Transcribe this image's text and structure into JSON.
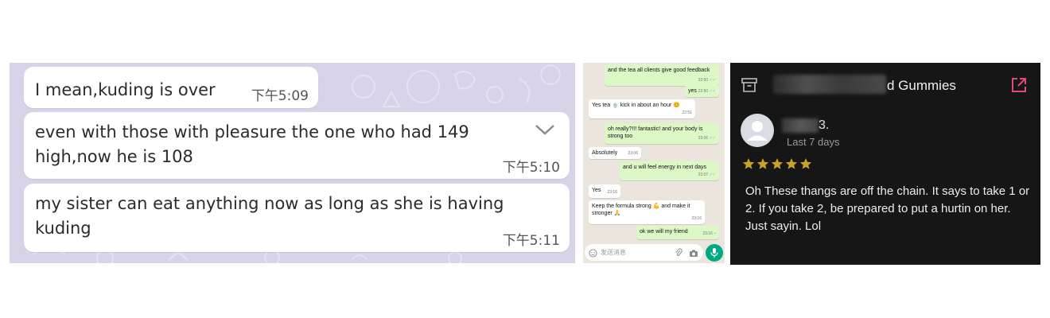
{
  "chat1": {
    "messages": [
      {
        "text": "I mean,kuding is over",
        "time": "下午5:09"
      },
      {
        "text": "even with those with pleasure the one who had 149 high,now he is 108",
        "time": "下午5:10"
      },
      {
        "text": "my sister can eat anything now as long as she is having kuding",
        "time": "下午5:11"
      }
    ]
  },
  "chat2": {
    "messages": [
      {
        "text": "and the tea all clients give good feedback",
        "time": "22:50"
      },
      {
        "text": "yes",
        "time": "22:50"
      },
      {
        "text": "Yes tea 🍵 kick in about an hour 😊",
        "time": "22:51"
      },
      {
        "text": "oh really?!!! fantastic! and your body is strong too",
        "time": "23:06"
      },
      {
        "text": "Absolutely",
        "time": "23:06"
      },
      {
        "text": "and u will feel energy in next days",
        "time": "23:07"
      },
      {
        "text": "Yes",
        "time": "23:16"
      },
      {
        "text": "Keep the formula strong 💪 and make it stronger 🙏",
        "time": "23:16"
      },
      {
        "text": "ok we will my friend",
        "time": "23:16"
      }
    ],
    "input_placeholder": "发送消息"
  },
  "review": {
    "title_suffix": "d Gummies",
    "reviewer_suffix": "3.",
    "date": "Last 7 days",
    "rating": 5,
    "text": "Oh These thangs are off the chain. It says to take 1 or 2. If you take 2, be prepared to put a hurtin on her. Just sayin. Lol"
  },
  "colors": {
    "chat1_bg": "#d9d3ea",
    "whatsapp_out": "#dcf8c6",
    "whatsapp_mic": "#00a884",
    "star": "#c9a227",
    "external_link": "#e3477f"
  }
}
